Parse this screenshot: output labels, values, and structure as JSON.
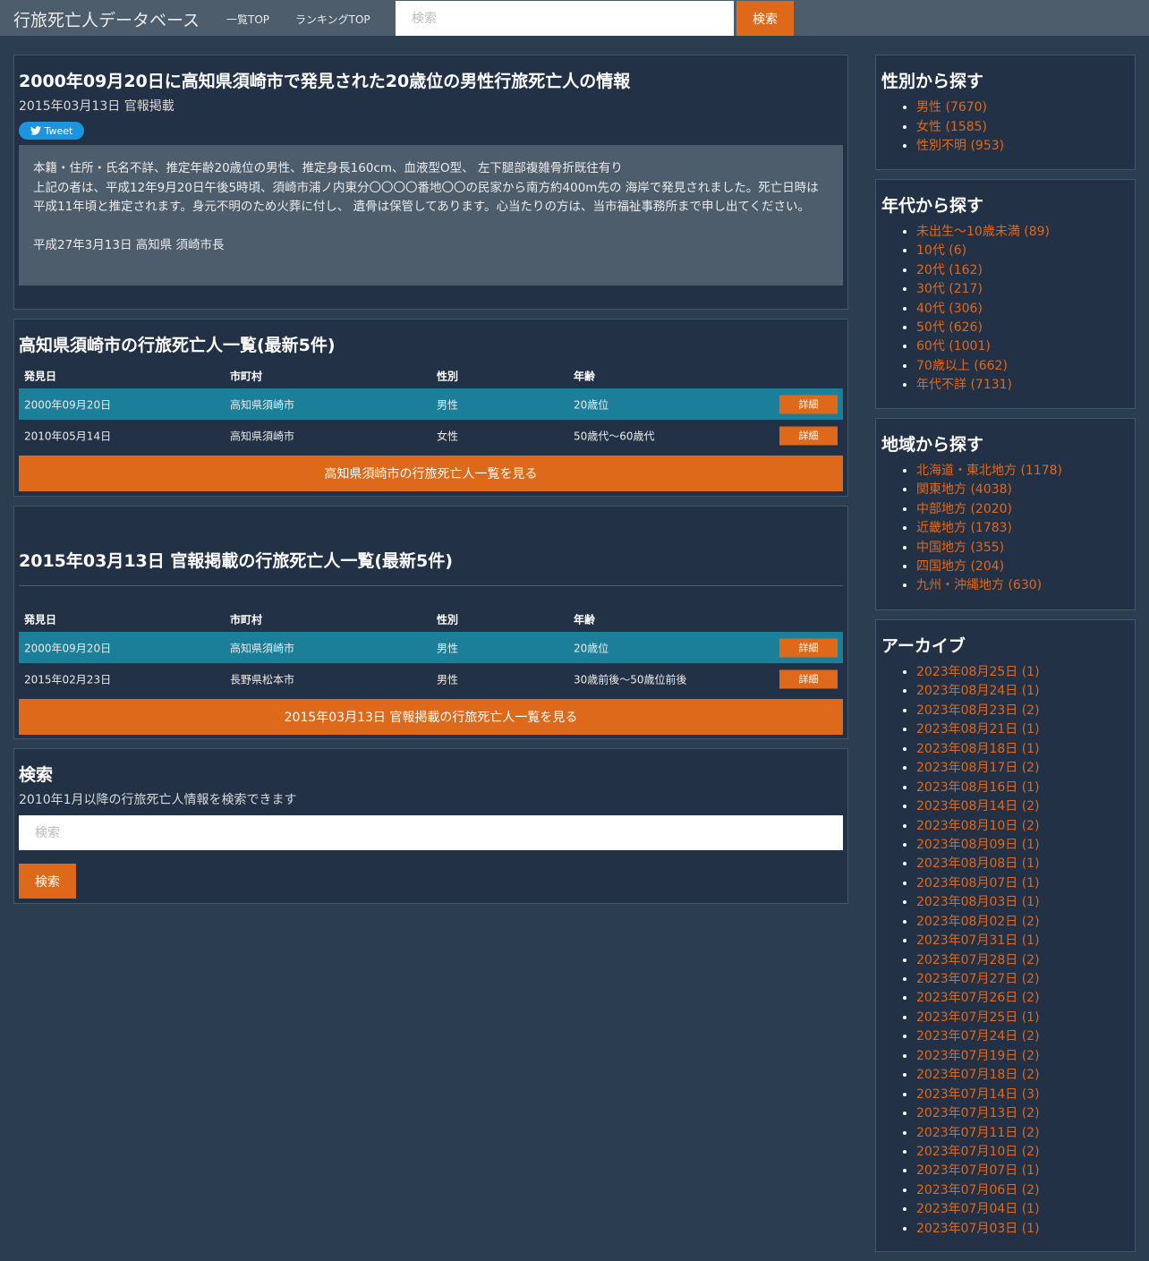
{
  "navbar": {
    "brand": "行旅死亡人データベース",
    "links": [
      "一覧TOP",
      "ランキングTOP"
    ],
    "search_placeholder": "検索",
    "search_button": "検索"
  },
  "article": {
    "title": "2000年09月20日に高知県須崎市で発見された20歳位の男性行旅死亡人の情報",
    "date": "2015年03月13日 官報掲載",
    "tweet": "Tweet",
    "body_lines": [
      "本籍・住所・氏名不詳、推定年齢20歳位の男性、推定身長160cm、血液型O型、 左下腿部複雑骨折既往有り",
      "上記の者は、平成12年9月20日午後5時頃、須崎市浦ノ内東分〇〇〇〇番地〇〇の民家から南方約400m先の 海岸で発見されました。死亡日時は平成11年頃と推定されます。身元不明のため火葬に付し、 遺骨は保管してあります。心当たりの方は、当市福祉事務所まで申し出てください。"
    ],
    "signature": "平成27年3月13日 高知県 須崎市長"
  },
  "city_list": {
    "title": "高知県須崎市の行旅死亡人一覧(最新5件)",
    "headers": [
      "発見日",
      "市町村",
      "性別",
      "年齢"
    ],
    "rows": [
      {
        "date": "2000年09月20日",
        "city": "高知県須崎市",
        "sex": "男性",
        "age": "20歳位",
        "btn": "詳細"
      },
      {
        "date": "2010年05月14日",
        "city": "高知県須崎市",
        "sex": "女性",
        "age": "50歳代〜60歳代",
        "btn": "詳細"
      }
    ],
    "more_button": "高知県須崎市の行旅死亡人一覧を見る"
  },
  "date_list": {
    "title": "2015年03月13日 官報掲載の行旅死亡人一覧(最新5件)",
    "headers": [
      "発見日",
      "市町村",
      "性別",
      "年齢"
    ],
    "rows": [
      {
        "date": "2000年09月20日",
        "city": "高知県須崎市",
        "sex": "男性",
        "age": "20歳位",
        "btn": "詳細"
      },
      {
        "date": "2015年02月23日",
        "city": "長野県松本市",
        "sex": "男性",
        "age": "30歳前後〜50歳位前後",
        "btn": "詳細"
      }
    ],
    "more_button": "2015年03月13日 官報掲載の行旅死亡人一覧を見る"
  },
  "search": {
    "title": "検索",
    "description": "2010年1月以降の行旅死亡人情報を検索できます",
    "placeholder": "検索",
    "button": "検索"
  },
  "sidebar": {
    "gender": {
      "title": "性別から探す",
      "items": [
        "男性 (7670)",
        "女性 (1585)",
        "性別不明 (953)"
      ]
    },
    "age": {
      "title": "年代から探す",
      "items": [
        "未出生〜10歳未満 (89)",
        "10代 (6)",
        "20代 (162)",
        "30代 (217)",
        "40代 (306)",
        "50代 (626)",
        "60代 (1001)",
        "70歳以上 (662)",
        "年代不詳 (7131)"
      ]
    },
    "region": {
      "title": "地域から探す",
      "items": [
        "北海道・東北地方 (1178)",
        "関東地方 (4038)",
        "中部地方 (2020)",
        "近畿地方 (1783)",
        "中国地方 (355)",
        "四国地方 (204)",
        "九州・沖縄地方 (630)"
      ]
    },
    "archive": {
      "title": "アーカイブ",
      "items": [
        "2023年08月25日 (1)",
        "2023年08月24日 (1)",
        "2023年08月23日 (2)",
        "2023年08月21日 (1)",
        "2023年08月18日 (1)",
        "2023年08月17日 (2)",
        "2023年08月16日 (1)",
        "2023年08月14日 (2)",
        "2023年08月10日 (2)",
        "2023年08月09日 (1)",
        "2023年08月08日 (1)",
        "2023年08月07日 (1)",
        "2023年08月03日 (1)",
        "2023年08月02日 (2)",
        "2023年07月31日 (1)",
        "2023年07月28日 (2)",
        "2023年07月27日 (2)",
        "2023年07月26日 (2)",
        "2023年07月25日 (1)",
        "2023年07月24日 (2)",
        "2023年07月19日 (2)",
        "2023年07月18日 (2)",
        "2023年07月14日 (3)",
        "2023年07月13日 (2)",
        "2023年07月11日 (2)",
        "2023年07月10日 (2)",
        "2023年07月07日 (1)",
        "2023年07月06日 (2)",
        "2023年07月04日 (1)",
        "2023年07月03日 (1)"
      ]
    }
  },
  "colors": {
    "background": "#2b3e50",
    "panel": "#233146",
    "navbar": "#4e5d6c",
    "accent": "#df691a",
    "highlight_row": "#1b7f9a"
  }
}
